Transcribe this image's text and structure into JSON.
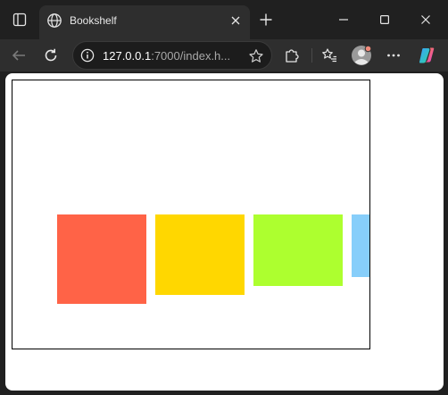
{
  "browser": {
    "tab": {
      "title": "Bookshelf"
    },
    "address": {
      "host": "127.0.0.1",
      "rest": ":7000/index.h..."
    }
  },
  "page": {
    "books": [
      {
        "color": "#ff6347"
      },
      {
        "color": "#ffd700"
      },
      {
        "color": "#adff2f"
      },
      {
        "color": "#87cefa"
      }
    ]
  }
}
